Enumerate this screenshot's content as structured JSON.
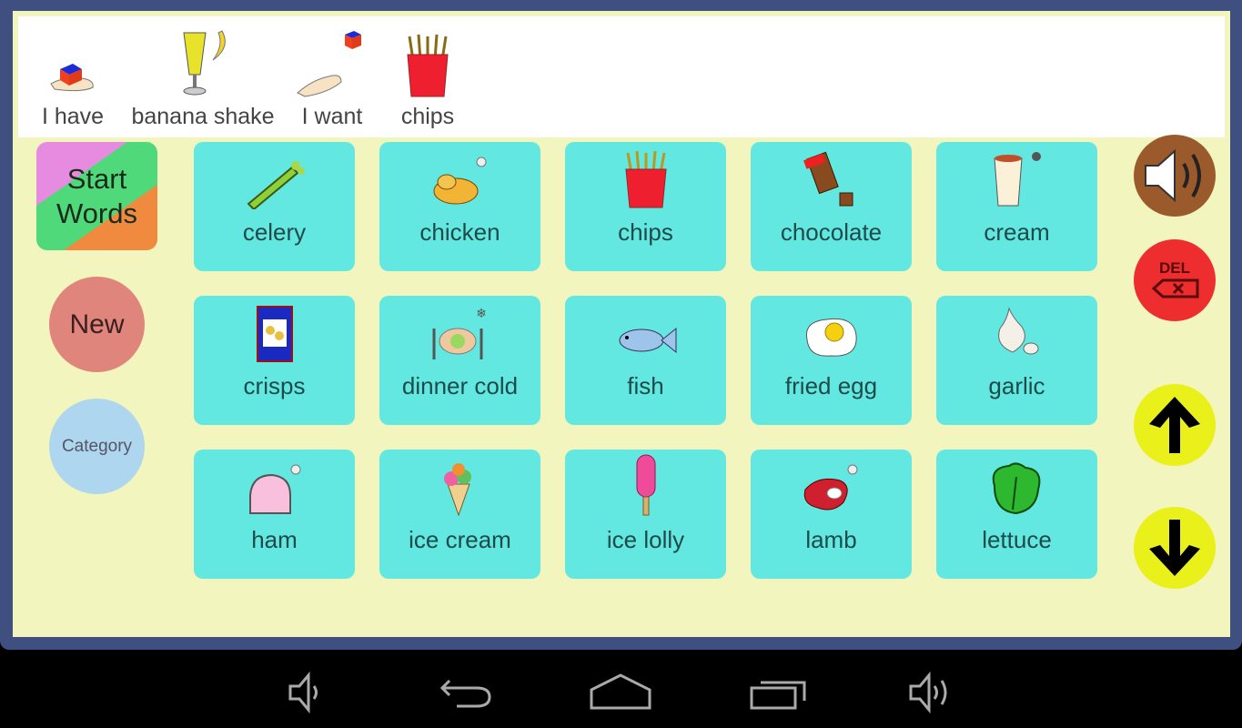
{
  "sentence_bar": {
    "items": [
      {
        "label": "I have",
        "icon": "have-icon"
      },
      {
        "label": "banana shake",
        "icon": "banana-shake-icon"
      },
      {
        "label": "I want",
        "icon": "want-icon"
      },
      {
        "label": "chips",
        "icon": "chips-icon"
      }
    ]
  },
  "left_controls": {
    "start_words_line1": "Start",
    "start_words_line2": "Words",
    "new_label": "New",
    "category_label": "Category"
  },
  "grid": {
    "tiles": [
      {
        "label": "celery"
      },
      {
        "label": "chicken"
      },
      {
        "label": "chips"
      },
      {
        "label": "chocolate"
      },
      {
        "label": "cream"
      },
      {
        "label": "crisps"
      },
      {
        "label": "dinner cold"
      },
      {
        "label": "fish"
      },
      {
        "label": "fried egg"
      },
      {
        "label": "garlic"
      },
      {
        "label": "ham"
      },
      {
        "label": "ice cream"
      },
      {
        "label": "ice lolly"
      },
      {
        "label": "lamb"
      },
      {
        "label": "lettuce"
      }
    ]
  },
  "right_controls": {
    "speak": "speaker-icon",
    "delete_label": "DEL",
    "up": "arrow-up-icon",
    "down": "arrow-down-icon"
  },
  "colors": {
    "frame": "#3f5080",
    "panel": "#f2f5bd",
    "tile": "#62e8e0",
    "speak": "#9b5a2b",
    "delete": "#ee2e2e",
    "arrows": "#eaf01a"
  },
  "system_nav": [
    "volume-down-icon",
    "back-icon",
    "home-icon",
    "recents-icon",
    "volume-up-icon"
  ]
}
